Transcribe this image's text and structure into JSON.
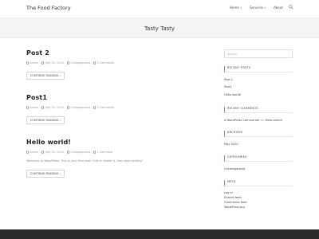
{
  "site": {
    "title": "The Food Factory"
  },
  "nav": {
    "home": "Home",
    "services": "Services",
    "about": "About"
  },
  "hero": {
    "title": "Tasty Tasty"
  },
  "posts": [
    {
      "title": "Post 2",
      "author": "admin",
      "date": "May 31, 2020",
      "category": "Uncategorized",
      "comments": "0 Comments",
      "excerpt": "",
      "button": "CONTINUE READING"
    },
    {
      "title": "Post1",
      "author": "admin",
      "date": "May 31, 2020",
      "category": "Uncategorized",
      "comments": "0 Comments",
      "excerpt": "",
      "button": "CONTINUE READING"
    },
    {
      "title": "Hello world!",
      "author": "admin",
      "date": "May 31, 2020",
      "category": "Uncategorized",
      "comments": "1 Comment",
      "excerpt": "Welcome to WordPress. This is your first post. Edit or delete it, then start writing!",
      "button": "CONTINUE READING"
    }
  ],
  "sidebar": {
    "search_placeholder": "Search",
    "recent_posts": {
      "title": "RECENT POSTS",
      "items": [
        "Post 2",
        "Post1",
        "Hello world!"
      ]
    },
    "recent_comments": {
      "title": "RECENT COMMENTS",
      "author": "A WordPress Commenter",
      "on": "on",
      "post": "Hello world!"
    },
    "archives": {
      "title": "ARCHIVES",
      "items": [
        "May 2020"
      ]
    },
    "categories": {
      "title": "CATEGORIES",
      "items": [
        "Uncategorized"
      ]
    },
    "meta": {
      "title": "META",
      "items": [
        "Log in",
        "Entries feed",
        "Comments feed",
        "WordPress.org"
      ]
    }
  },
  "colors": {
    "accent": "#36b6d0",
    "footer": "#2b2b2b",
    "hero_bg": "#f5f5f5"
  }
}
